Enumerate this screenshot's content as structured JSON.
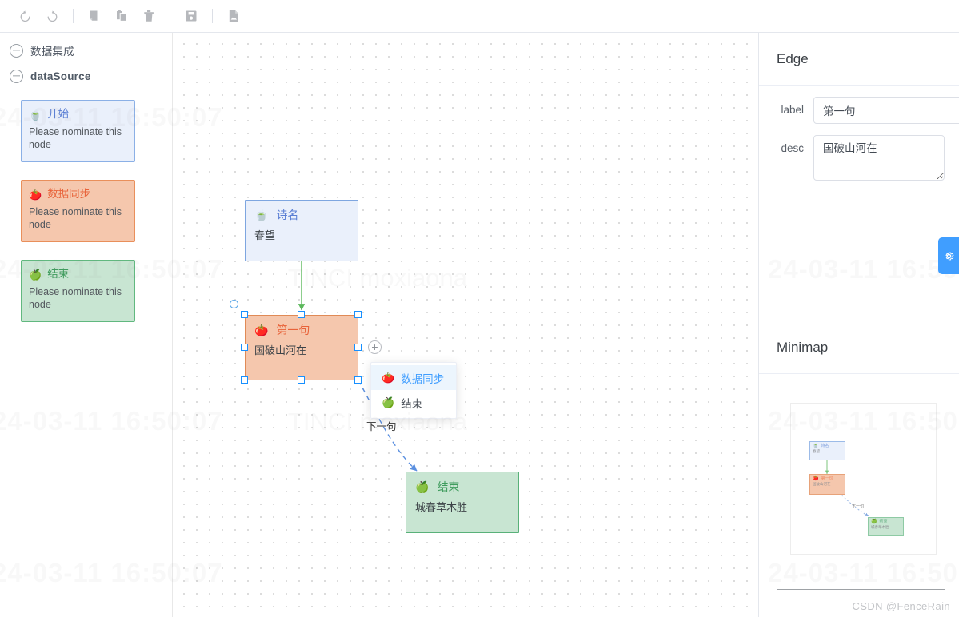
{
  "toolbar": {
    "buttons": [
      {
        "name": "undo",
        "label": "撤销"
      },
      {
        "name": "redo",
        "label": "重做"
      },
      {
        "name": "copy",
        "label": "复制"
      },
      {
        "name": "paste",
        "label": "粘贴"
      },
      {
        "name": "delete",
        "label": "删除"
      },
      {
        "name": "save",
        "label": "保存"
      },
      {
        "name": "export",
        "label": "导出图片"
      }
    ]
  },
  "sidebar": {
    "tree": [
      {
        "label": "数据集成",
        "expanded": true
      },
      {
        "label": "dataSource",
        "expanded": true
      }
    ],
    "palette": [
      {
        "emoji": "🍵",
        "title": "开始",
        "desc": "Please nominate this node",
        "color": "blue"
      },
      {
        "emoji": "🍅",
        "title": "数据同步",
        "desc": "Please nominate this node",
        "color": "org"
      },
      {
        "emoji": "🍏",
        "title": "结束",
        "desc": "Please nominate this node",
        "color": "grn"
      }
    ]
  },
  "canvas": {
    "nodes": [
      {
        "emoji": "🍵",
        "title": "诗名",
        "desc": "春望",
        "color": "blue"
      },
      {
        "emoji": "🍅",
        "title": "第一句",
        "desc": "国破山河在",
        "color": "org",
        "selected": true
      },
      {
        "emoji": "🍏",
        "title": "结束",
        "desc": "城春草木胜",
        "color": "grn"
      }
    ],
    "edge_label": "下一句",
    "plus_button": "+",
    "dropdown": [
      {
        "emoji": "🍅",
        "label": "数据同步",
        "active": true
      },
      {
        "emoji": "🍏",
        "label": "结束",
        "active": false
      }
    ]
  },
  "right_panel": {
    "edge_title": "Edge",
    "fields": [
      {
        "label": "label",
        "value": "第一句"
      },
      {
        "label": "desc",
        "value": "国破山河在"
      }
    ],
    "minimap_title": "Minimap",
    "minimap_nodes": [
      {
        "emoji": "🍵",
        "title": "诗名",
        "desc": "春望",
        "color": "blue"
      },
      {
        "emoji": "🍅",
        "title": "第一句",
        "desc": "国破山河在",
        "color": "org"
      },
      {
        "emoji": "🍏",
        "title": "结束",
        "desc": "城春草木胜",
        "color": "grn"
      }
    ],
    "minimap_edge_label": "下一句"
  },
  "watermark": {
    "csdn": "CSDN @FenceRain",
    "capture": "24-03-11  16:50:07",
    "brand": "TINCI  moxiaona"
  },
  "colors": {
    "accent": "#409eff",
    "blue_node": "#eaf0fb",
    "orange_node": "#f5c7ad",
    "green_node": "#c8e5d2",
    "selection": "#1890ff"
  }
}
